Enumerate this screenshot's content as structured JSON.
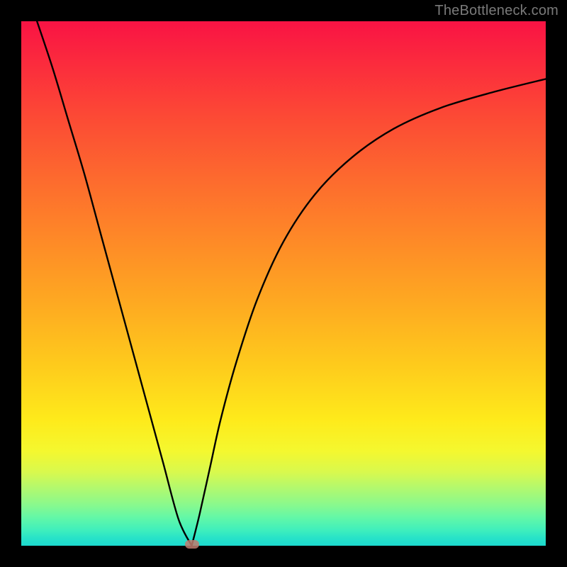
{
  "watermark": "TheBottleneck.com",
  "colors": {
    "frame": "#000000",
    "curve": "#000000",
    "marker": "#C07B6F",
    "gradient_top": "#F91344",
    "gradient_bottom": "#1CD9CE"
  },
  "chart_data": {
    "type": "line",
    "title": "",
    "xlabel": "",
    "ylabel": "",
    "xlim": [
      0,
      100
    ],
    "ylim": [
      0,
      100
    ],
    "grid": false,
    "legend": false,
    "curve_left": {
      "x": [
        3,
        6,
        9,
        12,
        15,
        18,
        21,
        24,
        27,
        30,
        32.5
      ],
      "y": [
        100,
        91,
        81,
        71,
        60,
        49,
        38,
        27,
        16,
        5,
        0
      ]
    },
    "curve_right": {
      "x": [
        32.5,
        34,
        36,
        38,
        41,
        45,
        50,
        56,
        63,
        71,
        80,
        90,
        100
      ],
      "y": [
        0,
        6,
        15,
        24,
        35,
        47,
        58,
        67,
        74,
        79.5,
        83.5,
        86.5,
        89
      ]
    },
    "minimum_marker": {
      "x": 32.5,
      "y": 0
    }
  }
}
